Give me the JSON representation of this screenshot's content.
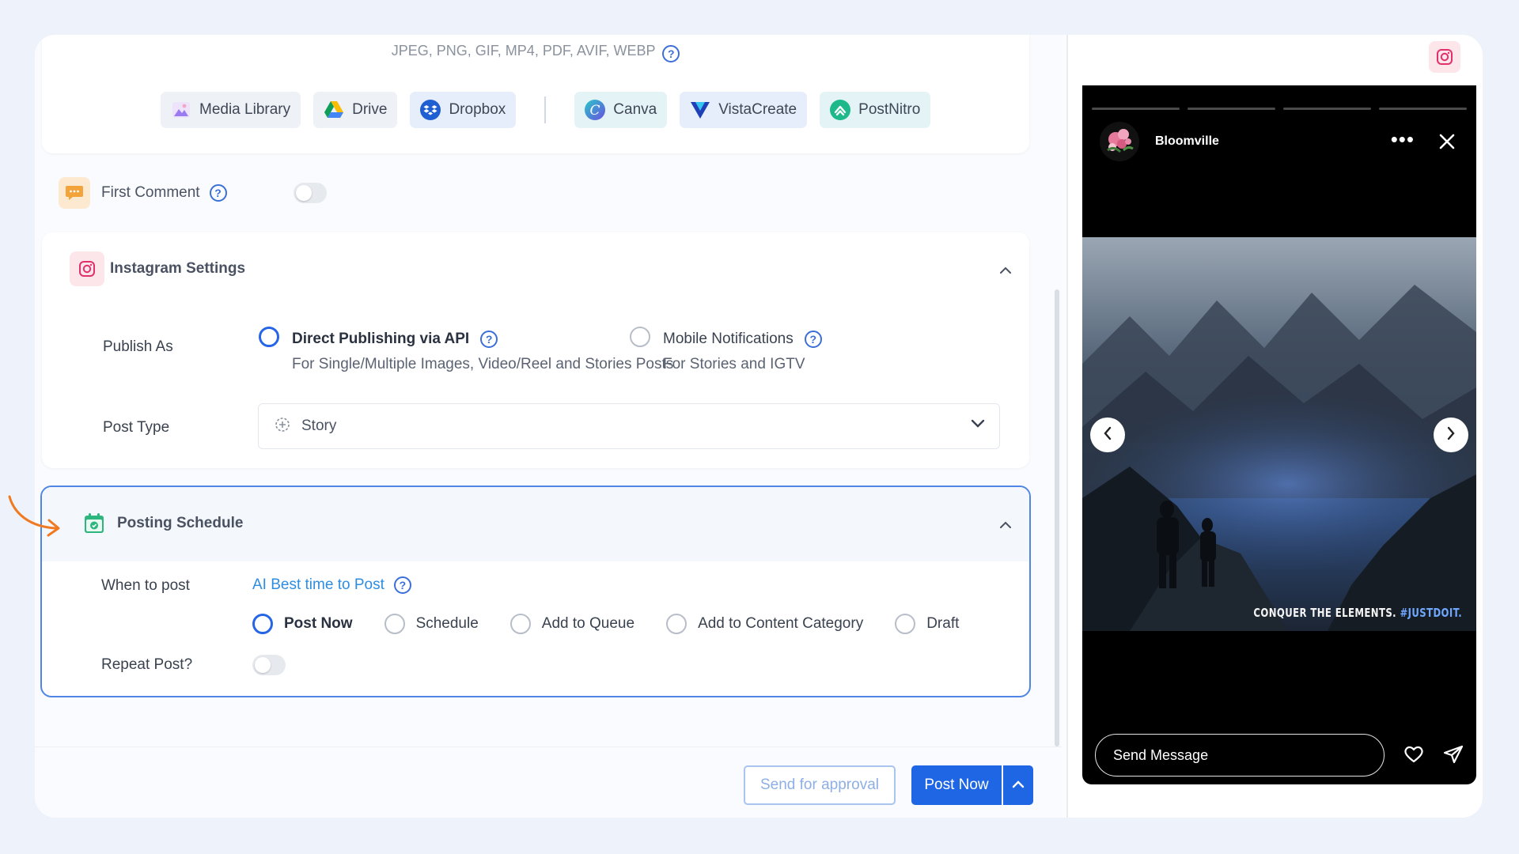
{
  "media": {
    "formats": "JPEG, PNG, GIF, MP4, PDF, AVIF, WEBP",
    "sources": [
      {
        "label": "Media Library",
        "icon": "image-icon"
      },
      {
        "label": "Drive",
        "icon": "google-drive-icon"
      },
      {
        "label": "Dropbox",
        "icon": "dropbox-icon"
      },
      {
        "label": "Canva",
        "icon": "canva-icon"
      },
      {
        "label": "VistaCreate",
        "icon": "vistacreate-icon"
      },
      {
        "label": "PostNitro",
        "icon": "postnitro-icon"
      }
    ]
  },
  "first_comment": {
    "label": "First Comment",
    "enabled": false
  },
  "instagram": {
    "title": "Instagram Settings",
    "publish_as_label": "Publish As",
    "options": [
      {
        "title": "Direct Publishing via API",
        "subtitle": "For Single/Multiple Images, Video/Reel and Stories Posts",
        "selected": true
      },
      {
        "title": "Mobile Notifications",
        "subtitle": "For Stories and IGTV",
        "selected": false
      }
    ],
    "post_type_label": "Post Type",
    "post_type_value": "Story"
  },
  "schedule": {
    "title": "Posting Schedule",
    "when_label": "When to post",
    "ai_link": "AI Best time to Post",
    "options": [
      {
        "label": "Post Now",
        "selected": true
      },
      {
        "label": "Schedule",
        "selected": false
      },
      {
        "label": "Add to Queue",
        "selected": false
      },
      {
        "label": "Add to Content Category",
        "selected": false
      },
      {
        "label": "Draft",
        "selected": false
      }
    ],
    "repeat_label": "Repeat Post?",
    "repeat_enabled": false
  },
  "footer": {
    "approval_label": "Send for approval",
    "post_label": "Post Now"
  },
  "preview": {
    "username": "Bloomville",
    "caption": "CONQUER THE ELEMENTS.",
    "hashtag": "#JUSTDOIT.",
    "message_placeholder": "Send Message",
    "progress_segments": 4
  },
  "colors": {
    "accent": "#1f66e5",
    "link": "#2e8de0",
    "annotation": "#f07a22"
  }
}
